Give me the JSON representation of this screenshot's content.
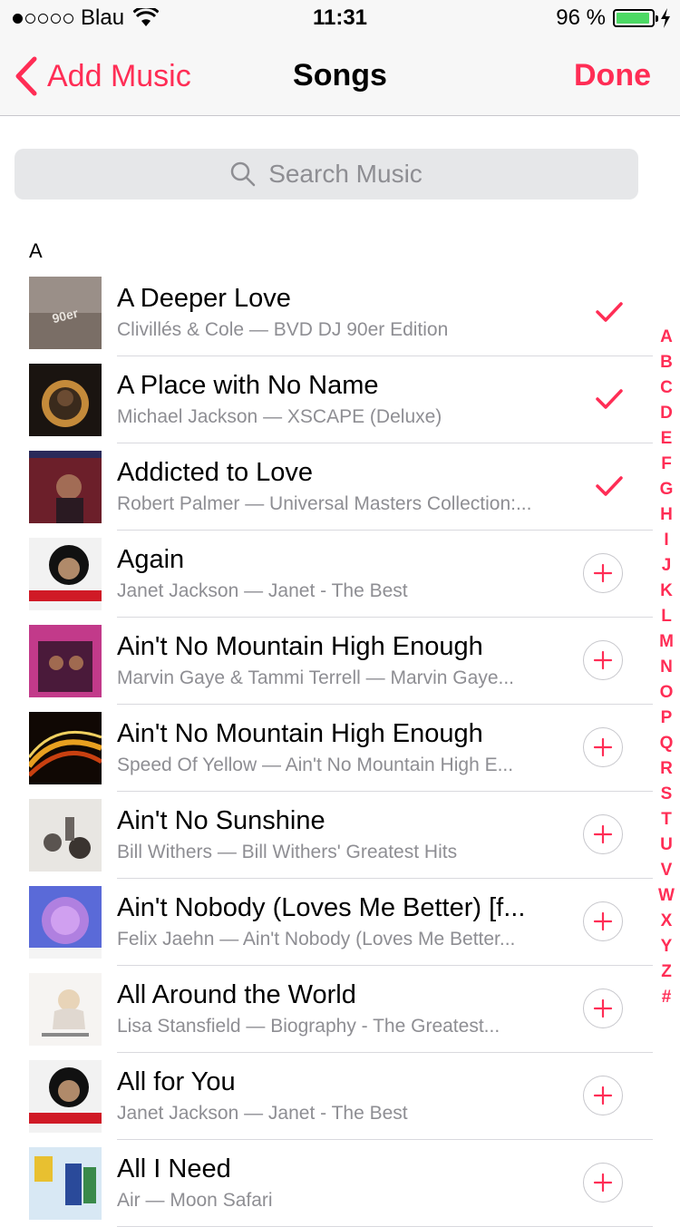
{
  "status_bar": {
    "carrier": "Blau",
    "time": "11:31",
    "battery": "96 %",
    "battery_level": 0.96
  },
  "nav": {
    "back_label": "Add Music",
    "title": "Songs",
    "done_label": "Done"
  },
  "search": {
    "placeholder": "Search Music"
  },
  "section_header": "A",
  "accent_color": "#ff2d55",
  "songs": [
    {
      "title": "A Deeper Love",
      "subtitle": "Clivillés & Cole — BVD DJ 90er Edition",
      "added": true
    },
    {
      "title": "A Place with No Name",
      "subtitle": "Michael Jackson — XSCAPE (Deluxe)",
      "added": true
    },
    {
      "title": "Addicted to Love",
      "subtitle": "Robert Palmer — Universal Masters Collection:...",
      "added": true
    },
    {
      "title": "Again",
      "subtitle": "Janet Jackson — Janet - The Best",
      "added": false
    },
    {
      "title": "Ain't No Mountain High Enough",
      "subtitle": "Marvin Gaye & Tammi Terrell — Marvin Gaye...",
      "added": false
    },
    {
      "title": "Ain't No Mountain High Enough",
      "subtitle": "Speed Of Yellow — Ain't No Mountain High E...",
      "added": false
    },
    {
      "title": "Ain't No Sunshine",
      "subtitle": "Bill Withers — Bill Withers' Greatest Hits",
      "added": false
    },
    {
      "title": "Ain't Nobody (Loves Me Better) [f...",
      "subtitle": "Felix Jaehn — Ain't Nobody (Loves Me Better...",
      "added": false
    },
    {
      "title": "All Around the World",
      "subtitle": "Lisa Stansfield — Biography - The Greatest...",
      "added": false
    },
    {
      "title": "All for You",
      "subtitle": "Janet Jackson — Janet - The Best",
      "added": false
    },
    {
      "title": "All I Need",
      "subtitle": "Air — Moon Safari",
      "added": false
    }
  ],
  "index_letters": [
    "A",
    "B",
    "C",
    "D",
    "E",
    "F",
    "G",
    "H",
    "I",
    "J",
    "K",
    "L",
    "M",
    "N",
    "O",
    "P",
    "Q",
    "R",
    "S",
    "T",
    "U",
    "V",
    "W",
    "X",
    "Y",
    "Z",
    "#"
  ]
}
